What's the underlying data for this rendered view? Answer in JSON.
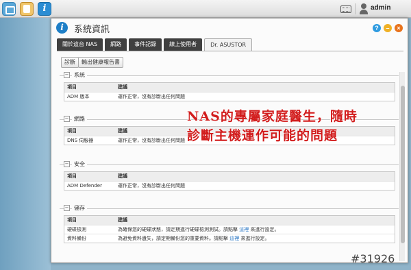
{
  "topbar": {
    "user": "admin"
  },
  "window": {
    "title": "系統資訊",
    "tabs": [
      "關於這台 NAS",
      "網路",
      "事件記錄",
      "線上使用者",
      "Dr. ASUSTOR"
    ],
    "buttons": {
      "diagnose": "診斷",
      "export_report": "輸出健康報告書"
    }
  },
  "sections": [
    {
      "title": "系統",
      "header": [
        "項目",
        "建議"
      ],
      "rows": [
        [
          "ADM 版本",
          "運作正常，沒有診斷出任何問題"
        ]
      ]
    },
    {
      "title": "網路",
      "header": [
        "項目",
        "建議"
      ],
      "rows": [
        [
          "DNS 伺服器",
          "運作正常，沒有診斷出任何問題"
        ]
      ]
    },
    {
      "title": "安全",
      "header": [
        "項目",
        "建議"
      ],
      "rows": [
        [
          "ADM Defender",
          "運作正常，沒有診斷出任何問題"
        ]
      ]
    },
    {
      "title": "儲存",
      "header": [
        "項目",
        "建議"
      ],
      "rows": [
        [
          "硬碟檢測",
          "為確保您的硬碟狀態，請定期進行硬碟檢測測試。請點擊",
          "這裡",
          "來進行設定。"
        ],
        [
          "資料備份",
          "為避免資料遺失，請定期備份您的重要資料。請點擊",
          "這裡",
          "來進行設定。"
        ]
      ]
    }
  ],
  "overlay": {
    "line1": "NAS的專屬家庭醫生，隨時",
    "line2": "診斷主機運作可能的問題"
  },
  "watermark": "#31926"
}
